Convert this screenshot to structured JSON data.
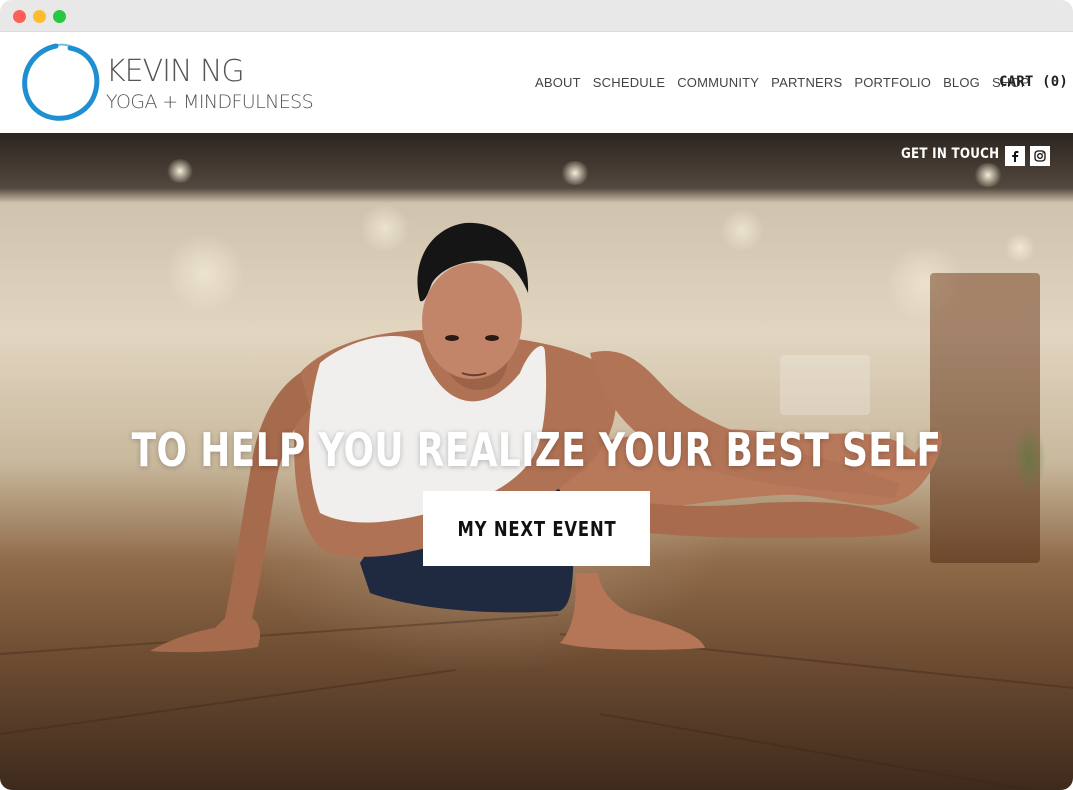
{
  "brand": {
    "name": "KEVIN NG",
    "tagline": "YOGA + MINDFULNESS",
    "accent_color": "#1e90d2"
  },
  "nav": {
    "items": [
      "ABOUT",
      "SCHEDULE",
      "COMMUNITY",
      "PARTNERS",
      "PORTFOLIO",
      "BLOG",
      "SHOP"
    ],
    "cart_label": "CART (0)"
  },
  "hero": {
    "get_in_touch": "GET IN TOUCH",
    "social_icons": [
      "facebook-icon",
      "instagram-icon"
    ],
    "headline": "TO HELP YOU REALIZE YOUR BEST SELF",
    "cta_label": "MY NEXT EVENT"
  }
}
